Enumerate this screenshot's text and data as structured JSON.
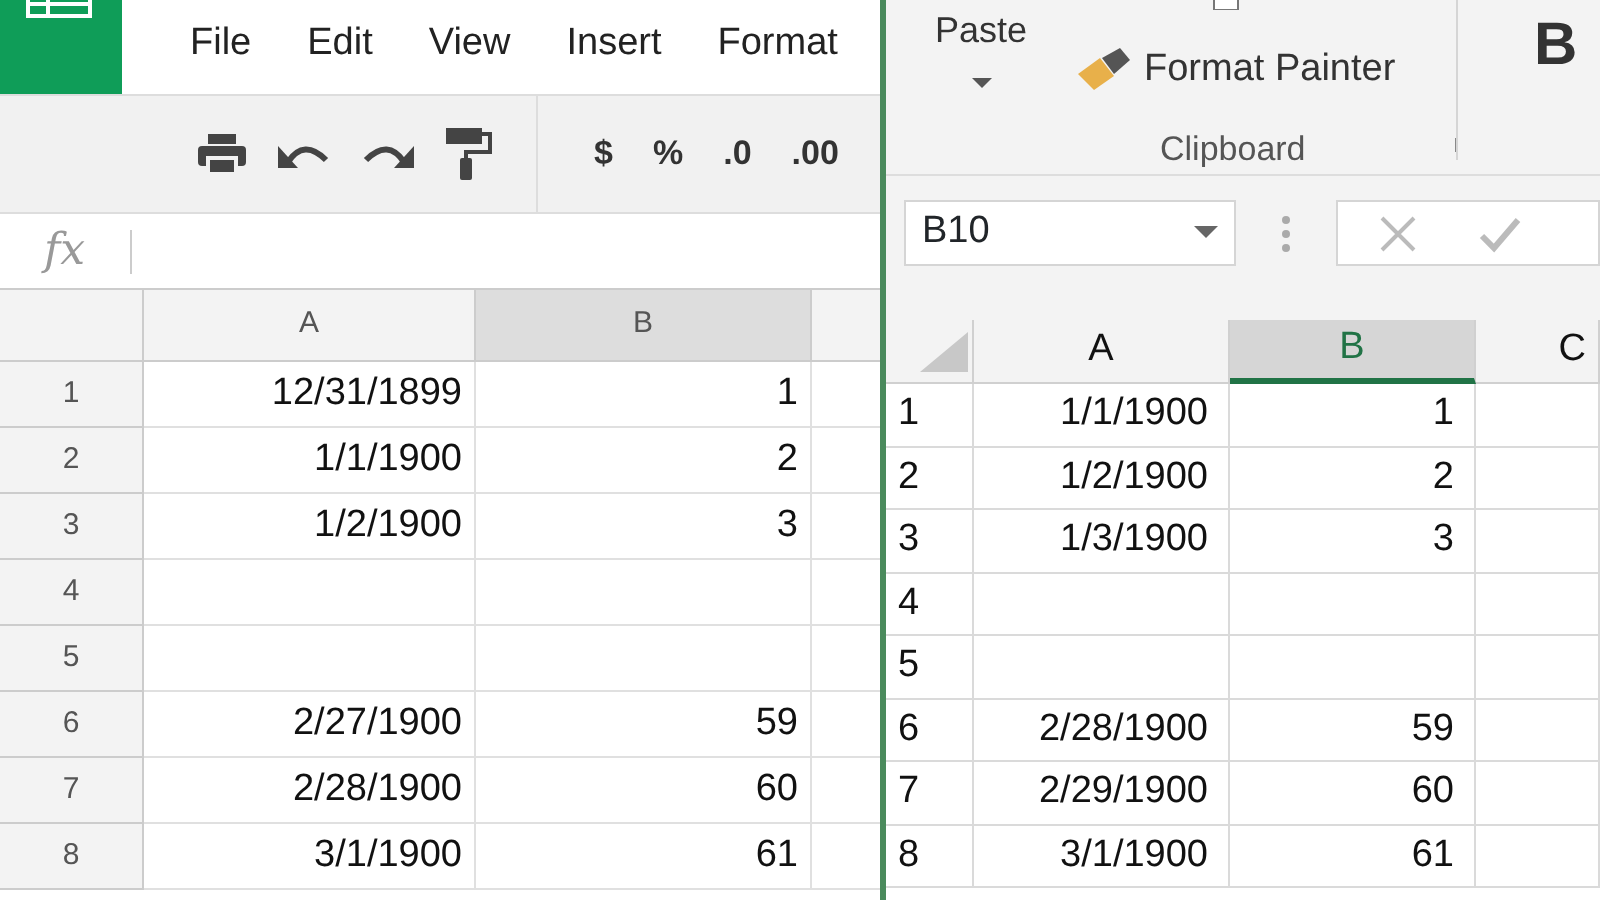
{
  "sheets": {
    "menu": [
      "File",
      "Edit",
      "View",
      "Insert",
      "Format"
    ],
    "format_buttons": [
      "$",
      "%",
      ".0",
      ".00"
    ],
    "formula_label": "fx",
    "columns": [
      {
        "label": "A",
        "selected": false
      },
      {
        "label": "B",
        "selected": true
      }
    ],
    "rows": [
      {
        "number": "1",
        "cells": [
          "12/31/1899",
          "1"
        ]
      },
      {
        "number": "2",
        "cells": [
          "1/1/1900",
          "2"
        ]
      },
      {
        "number": "3",
        "cells": [
          "1/2/1900",
          "3"
        ]
      },
      {
        "number": "4",
        "cells": [
          "",
          ""
        ]
      },
      {
        "number": "5",
        "cells": [
          "",
          ""
        ]
      },
      {
        "number": "6",
        "cells": [
          "2/27/1900",
          "59"
        ]
      },
      {
        "number": "7",
        "cells": [
          "2/28/1900",
          "60"
        ]
      },
      {
        "number": "8",
        "cells": [
          "3/1/1900",
          "61"
        ]
      }
    ]
  },
  "excel": {
    "paste": "Paste",
    "format_painter": "Format Painter",
    "group": "Clipboard",
    "bold": "B",
    "name_box": "B10",
    "columns": [
      {
        "label": "A",
        "selected": false
      },
      {
        "label": "B",
        "selected": true
      },
      {
        "label": "C",
        "selected": false
      }
    ],
    "rows": [
      {
        "number": "1",
        "cells": [
          "1/1/1900",
          "1"
        ]
      },
      {
        "number": "2",
        "cells": [
          "1/2/1900",
          "2"
        ]
      },
      {
        "number": "3",
        "cells": [
          "1/3/1900",
          "3"
        ]
      },
      {
        "number": "4",
        "cells": [
          "",
          ""
        ]
      },
      {
        "number": "5",
        "cells": [
          "",
          ""
        ]
      },
      {
        "number": "6",
        "cells": [
          "2/28/1900",
          "59"
        ]
      },
      {
        "number": "7",
        "cells": [
          "2/29/1900",
          "60"
        ]
      },
      {
        "number": "8",
        "cells": [
          "3/1/1900",
          "61"
        ]
      }
    ]
  }
}
